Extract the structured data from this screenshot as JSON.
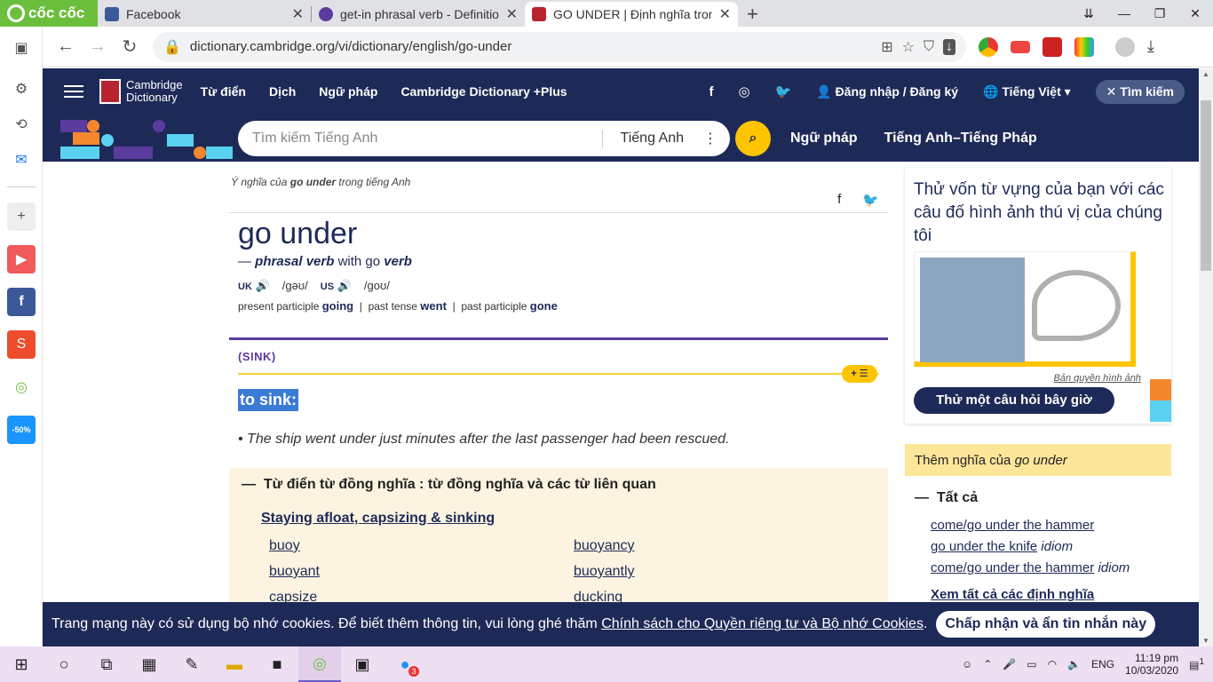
{
  "browser": {
    "brand": "cốc cốc",
    "tabs": [
      {
        "title": "Facebook",
        "color": "#3b5998"
      },
      {
        "title": "get-in phrasal verb - Definitio",
        "color": "#5c3b9e"
      },
      {
        "title": "GO UNDER | Định nghĩa trong",
        "color": "#b8232f"
      }
    ],
    "new_tab": "+",
    "url": "dictionary.cambridge.org/vi/dictionary/english/go-under"
  },
  "header": {
    "logo_line1": "Cambridge",
    "logo_line2": "Dictionary",
    "nav": [
      "Từ điển",
      "Dịch",
      "Ngữ pháp",
      "Cambridge Dictionary +Plus"
    ],
    "login": "Đăng nhập / Đăng ký",
    "language": "Tiếng Việt",
    "search_toggle": "Tìm kiếm"
  },
  "search": {
    "placeholder": "Tìm kiếm Tiếng Anh",
    "dictionary": "Tiếng Anh",
    "subnav": [
      "Ngữ pháp",
      "Tiếng Anh–Tiếng Pháp"
    ]
  },
  "entry": {
    "crumb_prefix": "Ý nghĩa của",
    "crumb_word": "go under",
    "crumb_suffix": "trong tiếng Anh",
    "headword": "go under",
    "pos_dash": "—",
    "pos": "phrasal verb",
    "pos_with": "with go",
    "pos_verb": "verb",
    "uk_label": "UK",
    "uk_ipa": "/gəʊ/",
    "us_label": "US",
    "us_ipa": "/ɡoʊ/",
    "pp_label": "present participle",
    "pp": "going",
    "pt_label": "past tense",
    "pt": "went",
    "past_p_label": "past participle",
    "past_p": "gone",
    "guide_word": "(SINK)",
    "definition": "to sink:",
    "example": "The ship went under just minutes after the last passenger had been rescued."
  },
  "thesaurus": {
    "heading": "Từ điển từ đồng nghĩa : từ đồng nghĩa và các từ liên quan",
    "topic": "Staying afloat, capsizing & sinking",
    "words": [
      "buoy",
      "buoyancy",
      "buoyant",
      "buoyantly",
      "capsize",
      "ducking"
    ]
  },
  "sidebar": {
    "quiz_title": "Thử vốn từ vựng của bạn với các câu đố hình ảnh thú vị của chúng tôi",
    "copyright": "Bản quyền hình ảnh",
    "quiz_button": "Thử một câu hỏi bây giờ",
    "more_prefix": "Thêm nghĩa của",
    "more_word": "go under",
    "all": "Tất cả",
    "links": [
      {
        "text": "come/go under the hammer",
        "tag": ""
      },
      {
        "text": "go under the knife",
        "tag": "idiom"
      },
      {
        "text": "come/go under the hammer",
        "tag": "idiom"
      }
    ],
    "see_all": "Xem tất cả các định nghĩa"
  },
  "cookie": {
    "text": "Trang mạng này có sử dụng bộ nhớ cookies. Để biết thêm thông tin, vui lòng ghé thăm",
    "link": "Chính sách cho Quyền riêng tư và Bộ nhớ Cookies",
    "dot": ".",
    "button": "Chấp nhận và ẩn tin nhắn này"
  },
  "taskbar": {
    "lang": "ENG",
    "time": "11:19 pm",
    "date": "10/03/2020",
    "notif": "1",
    "badge": "3"
  },
  "colors": {
    "brand_navy": "#1d2a57",
    "accent_yellow": "#fec400",
    "purple": "#5c3b9e"
  }
}
